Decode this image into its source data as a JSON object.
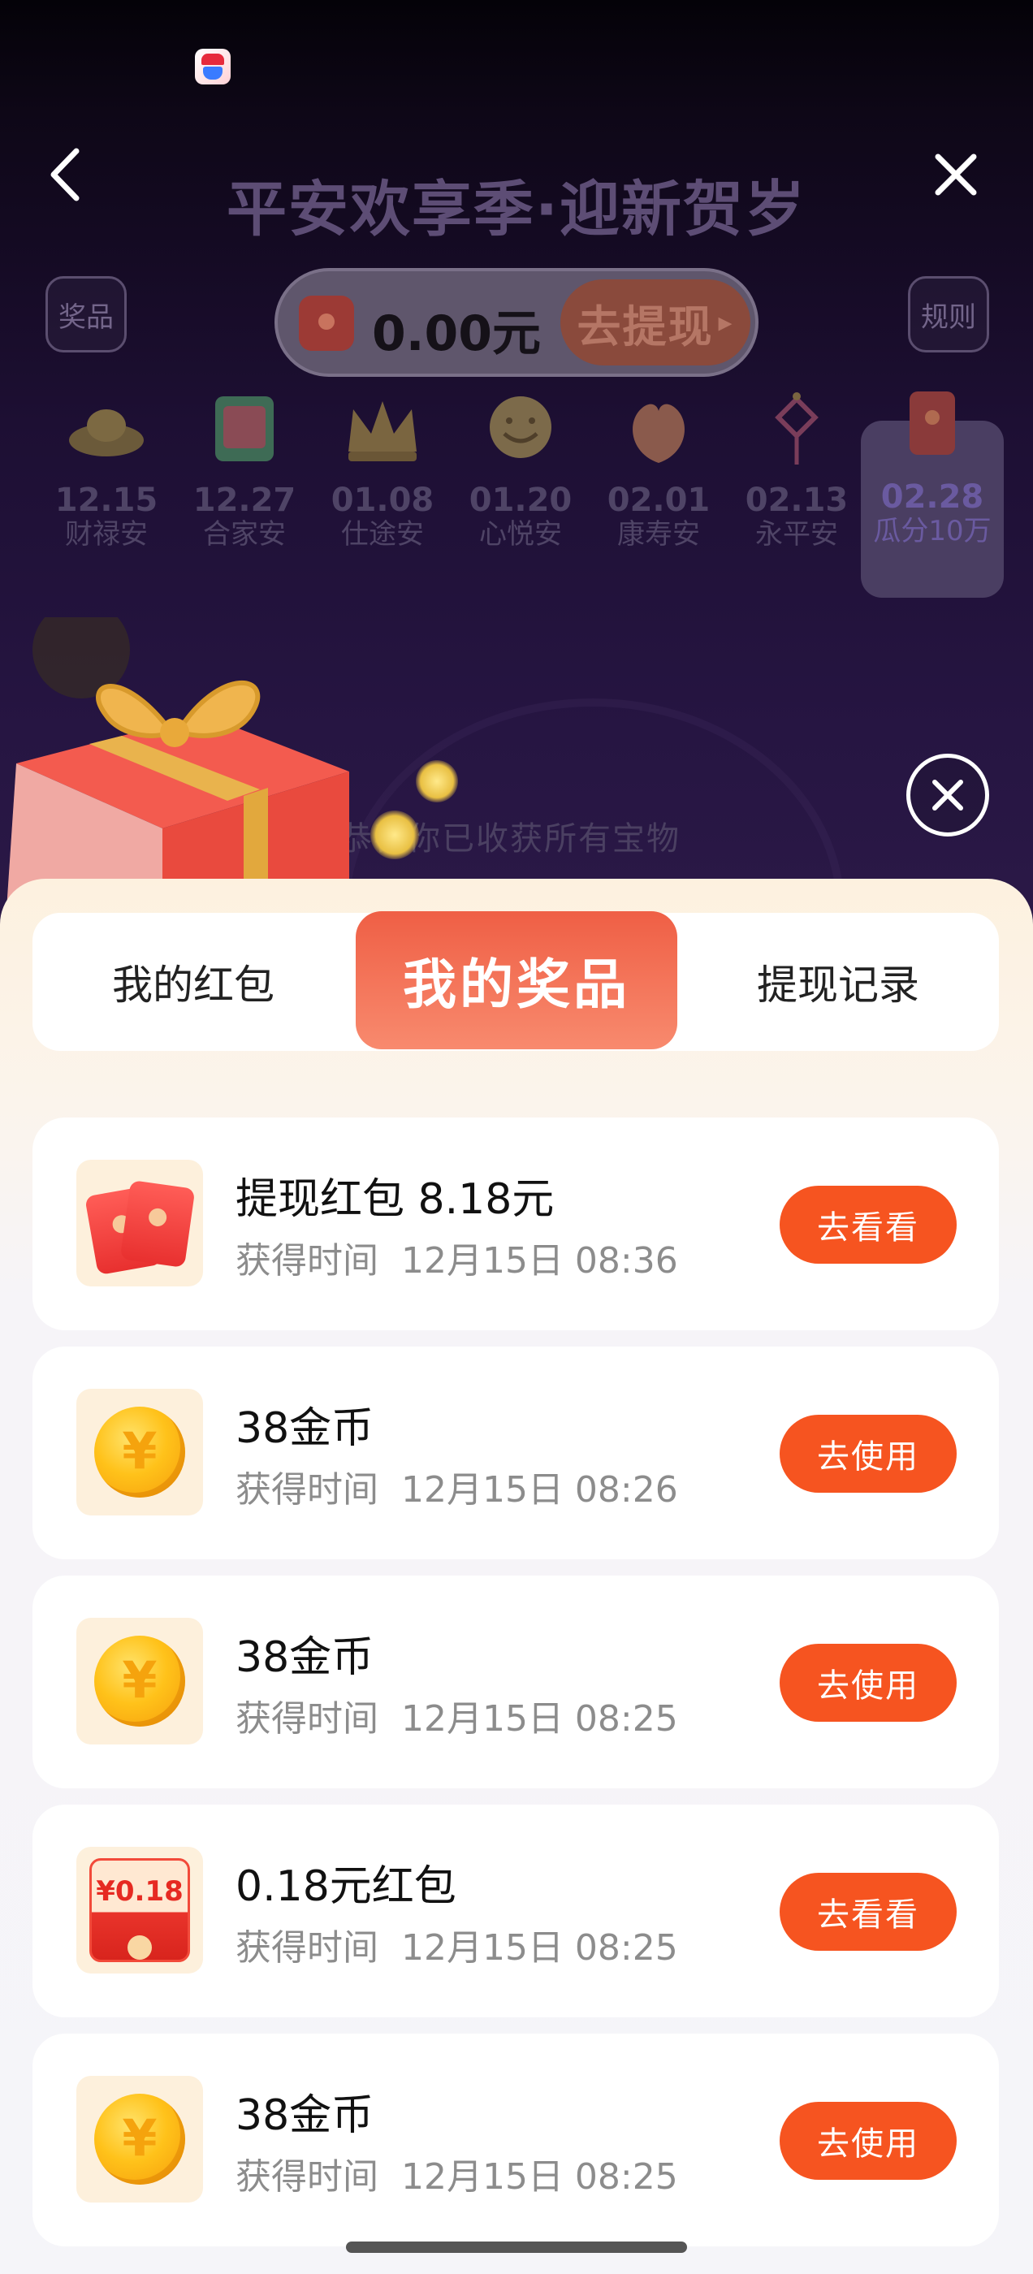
{
  "header": {
    "title": "平安欢享季·迎新贺岁",
    "prizes_label": "奖品",
    "rules_label": "规则",
    "balance": "0.00元",
    "withdraw_label": "去提现"
  },
  "timeline": [
    {
      "date": "12.15",
      "name": "财禄安",
      "icon": "gold-ingot-icon"
    },
    {
      "date": "12.27",
      "name": "合家安",
      "icon": "family-photo-icon"
    },
    {
      "date": "01.08",
      "name": "仕途安",
      "icon": "crown-icon"
    },
    {
      "date": "01.20",
      "name": "心悦安",
      "icon": "laughing-buddha-icon"
    },
    {
      "date": "02.01",
      "name": "康寿安",
      "icon": "peach-icon"
    },
    {
      "date": "02.13",
      "name": "永平安",
      "icon": "chinese-knot-icon"
    },
    {
      "date": "02.28",
      "name": "瓜分10万",
      "icon": "red-envelope-icon",
      "active": true
    }
  ],
  "overlay": {
    "congrats_text": "恭喜你已收获所有宝物"
  },
  "tabs": {
    "red_packets": "我的红包",
    "prizes": "我的奖品",
    "withdraw_records": "提现记录",
    "active": "prizes"
  },
  "prizes": [
    {
      "title": "提现红包 8.18元",
      "time": "获得时间  12月15日 08:36",
      "button": "去看看",
      "icon": "red-envelopes-icon"
    },
    {
      "title": "38金币",
      "time": "获得时间  12月15日 08:26",
      "button": "去使用",
      "icon": "gold-coin-icon"
    },
    {
      "title": "38金币",
      "time": "获得时间  12月15日 08:25",
      "button": "去使用",
      "icon": "gold-coin-icon"
    },
    {
      "title": "0.18元红包",
      "time": "获得时间  12月15日 08:25",
      "button": "去看看",
      "icon": "cash-envelope-icon",
      "icon_text": "¥0.18"
    },
    {
      "title": "38金币",
      "time": "获得时间  12月15日 08:25",
      "button": "去使用",
      "icon": "gold-coin-icon"
    }
  ],
  "colors": {
    "accent": "#f65420",
    "active_tab_top": "#ef5f45",
    "active_tab_bottom": "#f88a6e",
    "background_dark": "#1d0f33"
  }
}
